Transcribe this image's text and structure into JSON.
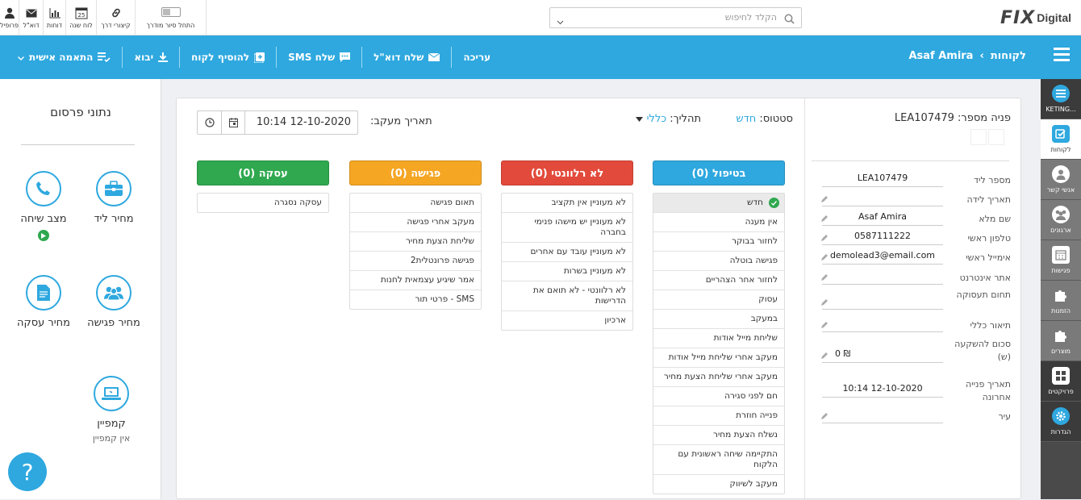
{
  "topbar": {
    "icons": [
      {
        "label": "פרופיל",
        "icon": "user-icon"
      },
      {
        "label": "דוא\"ל",
        "icon": "mail-icon"
      },
      {
        "label": "דוחות",
        "icon": "chart-icon"
      },
      {
        "label": "לוח שנה",
        "icon": "calendar-icon",
        "day": "25"
      },
      {
        "label": "קיצורי דרך",
        "icon": "link-icon"
      },
      {
        "label": "התחל סיור מודרך",
        "icon": "toggle-icon"
      }
    ],
    "search_placeholder": "הקלד לחיפוש",
    "logo_fix": "FIX",
    "logo_digital": "Digital"
  },
  "actionbar": {
    "breadcrumb_root": "לקוחות",
    "breadcrumb_sep": "›",
    "breadcrumb_current": "Asaf Amira",
    "actions": [
      "עריכה",
      "שלח דוא\"ל",
      "שלח SMS",
      "להוסיף לקוח",
      "יבוא",
      "התאמה אישית"
    ]
  },
  "leftpanel": {
    "title": "נתוני פרסום",
    "items": {
      "lead_price": "מחיר ליד",
      "call_status": "מצב שיחה",
      "meeting_price": "מחיר פגישה",
      "deal_price": "מחיר עסקה",
      "campaign": "קמפיין",
      "campaign_sub": "אין קמפיין"
    }
  },
  "rightnav": [
    {
      "label": "KETING...",
      "icon": "marketing-icon"
    },
    {
      "label": "לקוחות",
      "icon": "customers-icon"
    },
    {
      "label": "אנשי קשר",
      "icon": "contacts-icon"
    },
    {
      "label": "ארגונים",
      "icon": "organizations-icon"
    },
    {
      "label": "פגישות",
      "icon": "meetings-icon"
    },
    {
      "label": "הזמנות",
      "icon": "orders-icon"
    },
    {
      "label": "מוצרים",
      "icon": "products-icon"
    },
    {
      "label": "פרויקטים",
      "icon": "projects-icon"
    },
    {
      "label": "הגדרות",
      "icon": "settings-icon"
    }
  ],
  "detail": {
    "title": "פניה מספר: LEA107479",
    "fields": [
      {
        "label": "מספר ליד",
        "value": "LEA107479"
      },
      {
        "label": "תאריך לידה",
        "value": ""
      },
      {
        "label": "שם מלא",
        "value": "Asaf Amira"
      },
      {
        "label": "טלפון ראשי",
        "value": "0587111222"
      },
      {
        "label": "אימייל ראשי",
        "value": "demolead3@email.com"
      },
      {
        "label": "אתר אינטרנט",
        "value": ""
      },
      {
        "label": "תחום תעסוקה",
        "value": ""
      },
      {
        "label": "תיאור כללי",
        "value": ""
      },
      {
        "label": "סכום להשקעה (ש)",
        "value": "0 ₪"
      },
      {
        "label": "תאריך פנייה אחרונה",
        "value": "10:14 12-10-2020"
      },
      {
        "label": "עיר",
        "value": ""
      }
    ]
  },
  "board": {
    "status_label": "סטטוס:",
    "status_value": "חדש",
    "process_label": "תהליך:",
    "process_value": "כללי",
    "track_label": "תאריך מעקב:",
    "track_value": "10:14 12-10-2020",
    "columns": [
      {
        "title": "בטיפול (0)",
        "color": "#2ea8df",
        "items": [
          "חדש",
          "אין מענה",
          "לחזור בבוקר",
          "פגישה בוטלה",
          "לחזור אחר הצהריים",
          "עסוק",
          "במעקב",
          "שליחת מייל אודות",
          "מעקב אחרי שליחת מייל אודות",
          "מעקב אחרי שליחת הצעת מחיר",
          "חם לפני סגירה",
          "פנייה חוזרת",
          "נשלח הצעת מחיר",
          "התקיימה שיחה ראשונית עם הלקוח",
          "מעקב לשיווק"
        ]
      },
      {
        "title": "לא רלוונטי (0)",
        "color": "#e24a3b",
        "items": [
          "לא מעוניין אין תקציב",
          "לא מעוניין יש מישהו פנימי בחברה",
          "לא מעוניין עובד עם אחרים",
          "לא מעוניין בשרות",
          "לא רלוונטי - לא תואם את הדרישות",
          "ארכיון"
        ]
      },
      {
        "title": "פגישה (0)",
        "color": "#f5a623",
        "items": [
          "תאום פגישה",
          "מעקב אחרי פגישה",
          "שליחת הצעת מחיר",
          "פגישה פרונטלית2",
          "אמר שיגיע עצמאית לחנות",
          "SMS - פרטי תור"
        ]
      },
      {
        "title": "עסקה (0)",
        "color": "#2fa84f",
        "items": [
          "עסקה נסגרה"
        ]
      }
    ]
  }
}
